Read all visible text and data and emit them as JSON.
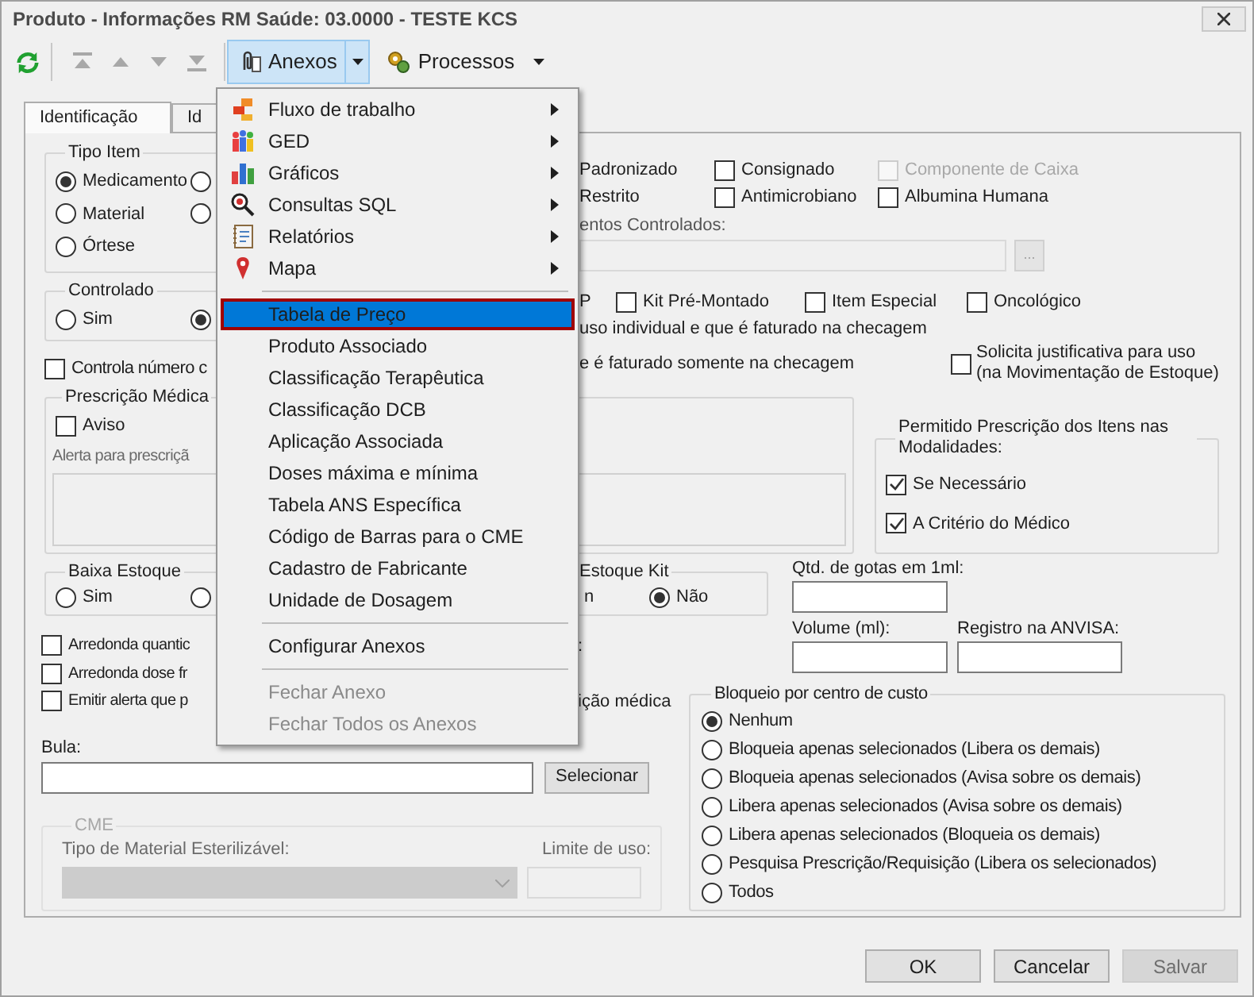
{
  "window": {
    "title": "Produto - Informações RM Saúde: 03.0000 - TESTE KCS"
  },
  "toolbar": {
    "nav_buttons": [
      {
        "kind": "first",
        "disabled": true
      },
      {
        "kind": "up",
        "disabled": true
      },
      {
        "kind": "down",
        "disabled": true
      },
      {
        "kind": "last",
        "disabled": true
      }
    ],
    "anexos": {
      "label": "Anexos",
      "open": true
    },
    "processos": {
      "label": "Processos"
    }
  },
  "tabs": [
    {
      "label": "Identificação",
      "selected": true
    },
    {
      "label": "Id",
      "selected": false
    }
  ],
  "tipo_item": {
    "title": "Tipo Item",
    "options": [
      {
        "label": "Medicamento",
        "selected": true
      },
      {
        "label": "Material",
        "selected": false
      },
      {
        "label": "Órtese",
        "selected": false
      }
    ],
    "column_2": [
      {
        "selected": false
      },
      {
        "selected": false
      }
    ]
  },
  "controlado": {
    "title": "Controlado",
    "options": [
      {
        "label": "Sim",
        "selected": false
      },
      {
        "selected": true
      }
    ]
  },
  "controla_numero": {
    "label": "Controla número c",
    "checked": false
  },
  "top_fragments": [
    "Padronizado",
    "Restrito"
  ],
  "top_checkboxes": [
    {
      "label": "Consignado",
      "checked": false,
      "disabled": false
    },
    {
      "label": "Componente de Caixa",
      "checked": false,
      "disabled": true
    },
    {
      "label": "Antimicrobiano",
      "checked": false,
      "disabled": false
    },
    {
      "label": "Albumina Humana",
      "checked": false,
      "disabled": false
    }
  ],
  "controlados": {
    "label": "entos Controlados:",
    "browse": "...",
    "disabled": true
  },
  "row_fragment": "P",
  "row_checkboxes": [
    {
      "label": "Kit Pré-Montado",
      "checked": false
    },
    {
      "label": "Item Especial",
      "checked": false
    },
    {
      "label": "Oncológico",
      "checked": false
    }
  ],
  "line_fragments": [
    "uso individual e que é faturado na checagem",
    "e é faturado somente na checagem"
  ],
  "solicita": {
    "lines": [
      "Solicita justificativa para uso",
      "(na Movimentação de Estoque)"
    ],
    "checked": false
  },
  "prescricao": {
    "title": "Prescrição Médica",
    "aviso": {
      "label": "Aviso",
      "checked": false
    },
    "alert_label": "Alerta para prescriçã"
  },
  "permitido": {
    "title": "Permitido Prescrição dos Itens nas Modalidades:",
    "options": [
      {
        "label": "Se Necessário",
        "checked": true
      },
      {
        "label": "A Critério do Médico",
        "checked": true
      }
    ]
  },
  "baixa_estoque": {
    "title": "Baixa Estoque",
    "options": [
      {
        "label": "Sim",
        "selected": false
      },
      {
        "selected": false
      }
    ]
  },
  "estoque_kit": {
    "title": "Estoque Kit",
    "fragment": "n",
    "options": [
      {
        "label": "Não",
        "selected": true
      }
    ]
  },
  "fields": [
    {
      "label": "Qtd. de gotas em 1ml:"
    },
    {
      "label": "Volume (ml):"
    },
    {
      "label": "Registro na ANVISA:"
    }
  ],
  "option_checkboxes": [
    {
      "label": "Arredonda quantic",
      "checked": false,
      "tail": ":"
    },
    {
      "label": "Arredonda dose fr",
      "checked": false
    },
    {
      "label": "Emitir alerta que p",
      "checked": false,
      "tail": "ição médica"
    }
  ],
  "bula": {
    "label": "Bula:",
    "button": "Selecionar"
  },
  "cme": {
    "title": "CME",
    "disabled": true,
    "type_label": "Tipo de Material Esterilizável:",
    "limit_label": "Limite de uso:"
  },
  "bloqueio": {
    "title": "Bloqueio por centro de custo",
    "options": [
      {
        "label": "Nenhum",
        "selected": true
      },
      {
        "label": "Bloqueia apenas selecionados (Libera os demais)",
        "selected": false
      },
      {
        "label": "Bloqueia apenas selecionados (Avisa sobre os demais)",
        "selected": false
      },
      {
        "label": "Libera apenas selecionados (Avisa sobre os demais)",
        "selected": false
      },
      {
        "label": "Libera apenas selecionados (Bloqueia os demais)",
        "selected": false
      },
      {
        "label": "Pesquisa Prescrição/Requisição (Libera os selecionados)",
        "selected": false
      },
      {
        "label": "Todos",
        "selected": false
      }
    ]
  },
  "buttons": [
    {
      "label": "OK",
      "disabled": false
    },
    {
      "label": "Cancelar",
      "disabled": false
    },
    {
      "label": "Salvar",
      "disabled": true
    }
  ],
  "menu": {
    "items": [
      {
        "kind": "submenu",
        "label": "Fluxo de trabalho",
        "selected": false,
        "disabled": false
      },
      {
        "kind": "submenu",
        "label": "GED",
        "selected": false,
        "disabled": false
      },
      {
        "kind": "submenu",
        "label": "Gráficos",
        "selected": false,
        "disabled": false
      },
      {
        "kind": "submenu",
        "label": "Consultas SQL",
        "selected": false,
        "disabled": false
      },
      {
        "kind": "submenu",
        "label": "Relatórios",
        "selected": false,
        "disabled": false
      },
      {
        "kind": "submenu",
        "label": "Mapa",
        "selected": false,
        "disabled": false
      },
      {
        "kind": "separator"
      },
      {
        "kind": "item",
        "label": "Tabela de Preço",
        "selected": true,
        "disabled": false
      },
      {
        "kind": "item",
        "label": "Produto Associado",
        "selected": false,
        "disabled": false
      },
      {
        "kind": "item",
        "label": "Classificação Terapêutica",
        "selected": false,
        "disabled": false
      },
      {
        "kind": "item",
        "label": "Classificação DCB",
        "selected": false,
        "disabled": false
      },
      {
        "kind": "item",
        "label": "Aplicação Associada",
        "selected": false,
        "disabled": false
      },
      {
        "kind": "item",
        "label": "Doses máxima e mínima",
        "selected": false,
        "disabled": false
      },
      {
        "kind": "item",
        "label": "Tabela ANS Específica",
        "selected": false,
        "disabled": false
      },
      {
        "kind": "item",
        "label": "Código de Barras para o CME",
        "selected": false,
        "disabled": false
      },
      {
        "kind": "item",
        "label": "Cadastro de Fabricante",
        "selected": false,
        "disabled": false
      },
      {
        "kind": "item",
        "label": "Unidade de Dosagem",
        "selected": false,
        "disabled": false
      },
      {
        "kind": "separator"
      },
      {
        "kind": "item",
        "label": "Configurar Anexos",
        "selected": false,
        "disabled": false
      },
      {
        "kind": "separator"
      },
      {
        "kind": "item",
        "label": "Fechar Anexo",
        "selected": false,
        "disabled": true
      },
      {
        "kind": "item",
        "label": "Fechar Todos os Anexos",
        "selected": false,
        "disabled": true
      }
    ]
  }
}
